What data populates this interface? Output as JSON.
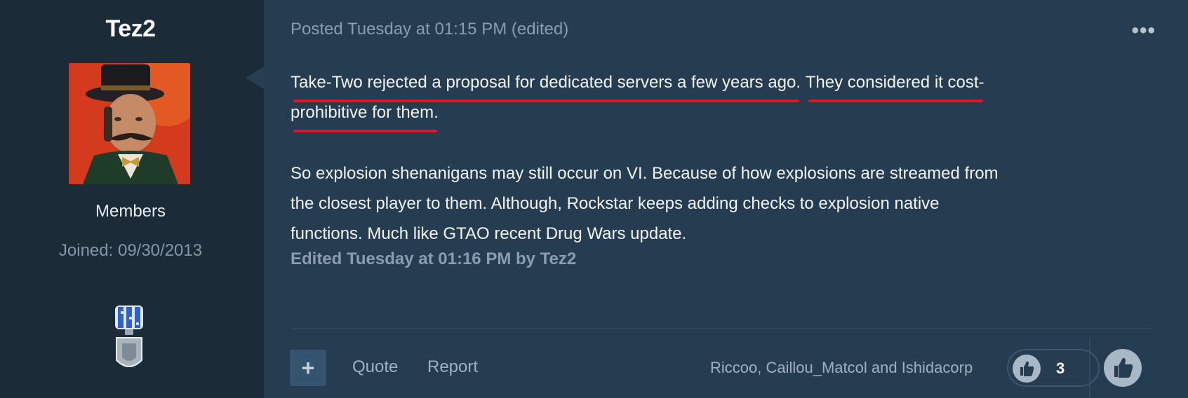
{
  "author": {
    "name": "Tez2",
    "group": "Members",
    "joined": "Joined: 09/30/2013",
    "avatar_icon": "avatar-image",
    "badge_icon": "medal-badge-icon"
  },
  "post": {
    "meta": "Posted Tuesday at 01:15 PM (edited)",
    "menu_icon": "ellipsis-icon",
    "menu_label": "•••",
    "para1": {
      "l1a": "Take-Two rejected a proposal for dedicated servers a few years ago.",
      "l1b": "They considered it cost-",
      "l2": "prohibitive for them."
    },
    "para2": [
      "So explosion shenanigans may still occur on VI. Because of how explosions are streamed from",
      "the closest player to them. Although, Rockstar keeps adding checks to explosion native",
      "functions. Much like GTAO recent Drug Wars update."
    ],
    "edited": "Edited Tuesday at 01:16 PM by Tez2",
    "highlight_color": "#e01523"
  },
  "footer": {
    "plus_label": "+",
    "quote_label": "Quote",
    "report_label": "Report",
    "reactors": "Riccoo, Caillou_Matcol and Ishidacorp",
    "reaction_count": "3",
    "reaction_icon": "thumbs-up-icon"
  }
}
